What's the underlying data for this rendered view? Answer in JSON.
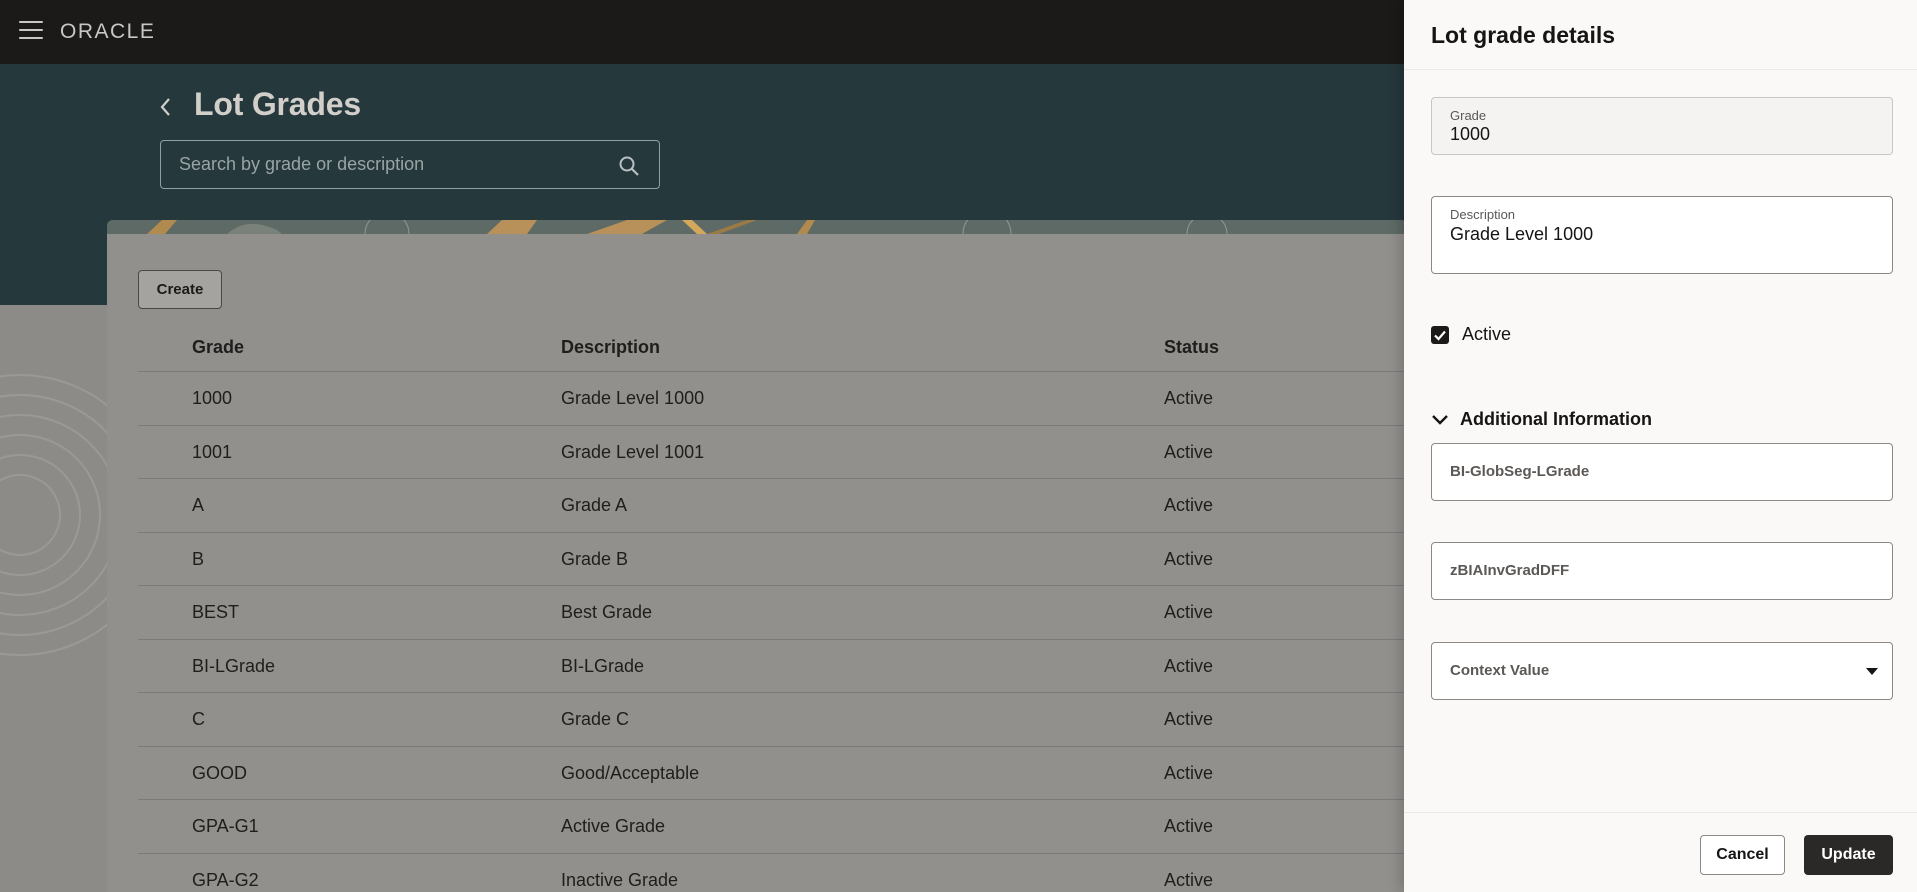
{
  "topbar": {
    "menu_icon": "hamburger-menu-icon",
    "logo_text": "ORACLE"
  },
  "page": {
    "title": "Lot Grades",
    "back_icon": "chevron-left-icon",
    "search_placeholder": "Search by grade or description",
    "search_icon": "search-icon",
    "create_label": "Create"
  },
  "table": {
    "headers": [
      "Grade",
      "Description",
      "Status"
    ],
    "rows": [
      [
        "1000",
        "Grade Level 1000",
        "Active"
      ],
      [
        "1001",
        "Grade Level 1001",
        "Active"
      ],
      [
        "A",
        "Grade A",
        "Active"
      ],
      [
        "B",
        "Grade B",
        "Active"
      ],
      [
        "BEST",
        "Best Grade",
        "Active"
      ],
      [
        "BI-LGrade",
        "BI-LGrade",
        "Active"
      ],
      [
        "C",
        "Grade C",
        "Active"
      ],
      [
        "GOOD",
        "Good/Acceptable",
        "Active"
      ],
      [
        "GPA-G1",
        "Active Grade",
        "Active"
      ],
      [
        "GPA-G2",
        "Inactive Grade",
        "Active"
      ]
    ]
  },
  "drawer": {
    "title": "Lot grade details",
    "grade_label": "Grade",
    "grade_value": "1000",
    "description_label": "Description",
    "description_value": "Grade Level 1000",
    "active_label": "Active",
    "active_checked": true,
    "section_title": "Additional Information",
    "section_icon": "chevron-down-icon",
    "field1_value": "BI-GlobSeg-LGrade",
    "field2_value": "zBIAInvGradDFF",
    "context_placeholder": "Context Value",
    "dropdown_icon": "caret-down-icon",
    "cancel_label": "Cancel",
    "update_label": "Update"
  },
  "colors": {
    "topbar": "#1b1a19",
    "header_band": "#25383c",
    "overlay_bg": "#8d8b88",
    "drawer_bg": "#fbf9f8",
    "primary_button": "#2b2928"
  }
}
